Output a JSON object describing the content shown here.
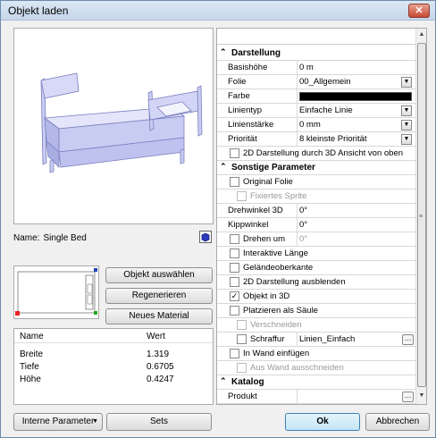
{
  "window": {
    "title": "Objekt laden",
    "close": "✕"
  },
  "preview": {
    "name_label": "Name:",
    "name_value": "Single Bed"
  },
  "buttons": {
    "select_object": "Objekt auswählen",
    "regenerate": "Regenerieren",
    "new_material": "Neues Material",
    "internal_params": "Interne Parameter",
    "sets": "Sets",
    "ok": "Ok",
    "cancel": "Abbrechen"
  },
  "params_table": {
    "col_name": "Name",
    "col_value": "Wert",
    "rows": [
      {
        "name": "Breite",
        "value": "1.319"
      },
      {
        "name": "Tiefe",
        "value": "0.6705"
      },
      {
        "name": "Höhe",
        "value": "0.4247"
      }
    ]
  },
  "props": {
    "sec_darstellung": "Darstellung",
    "basishoehe": {
      "label": "Basishöhe",
      "value": "0 m"
    },
    "folie": {
      "label": "Folie",
      "value": "00_Allgemein"
    },
    "farbe": {
      "label": "Farbe",
      "color": "#000000"
    },
    "linientyp": {
      "label": "Linientyp",
      "value": "Einfache Linie"
    },
    "linienstaerke": {
      "label": "Linienstärke",
      "value": "0 mm"
    },
    "prioritaet": {
      "label": "Priorität",
      "value": "8 kleinste Priorität"
    },
    "darst2d": "2D Darstellung durch 3D Ansicht von oben",
    "sec_sonstige": "Sonstige Parameter",
    "original_folie": "Original Folie",
    "fixiertes_sprite": "Fixiertes Sprite",
    "drehwinkel": {
      "label": "Drehwinkel 3D",
      "value": "0°"
    },
    "kippwinkel": {
      "label": "Kippwinkel",
      "value": "0°"
    },
    "drehen_um": {
      "label": "Drehen um",
      "value": "0°"
    },
    "interaktive_laenge": "Interaktive Länge",
    "gelaende": "Geländeoberkante",
    "darst2d_aus": "2D Darstellung ausblenden",
    "objekt_3d": "Objekt in 3D",
    "platzieren": "Platzieren als Säule",
    "verschneiden": "Verschneiden",
    "schraffur": {
      "label": "Schraffur",
      "value": "Linien_Einfach"
    },
    "in_wand": "In Wand einfügen",
    "aus_wand": "Aus Wand ausschneiden",
    "sec_katalog": "Katalog",
    "produkt": {
      "label": "Produkt",
      "value": ""
    }
  },
  "scroll_grip": "≡"
}
